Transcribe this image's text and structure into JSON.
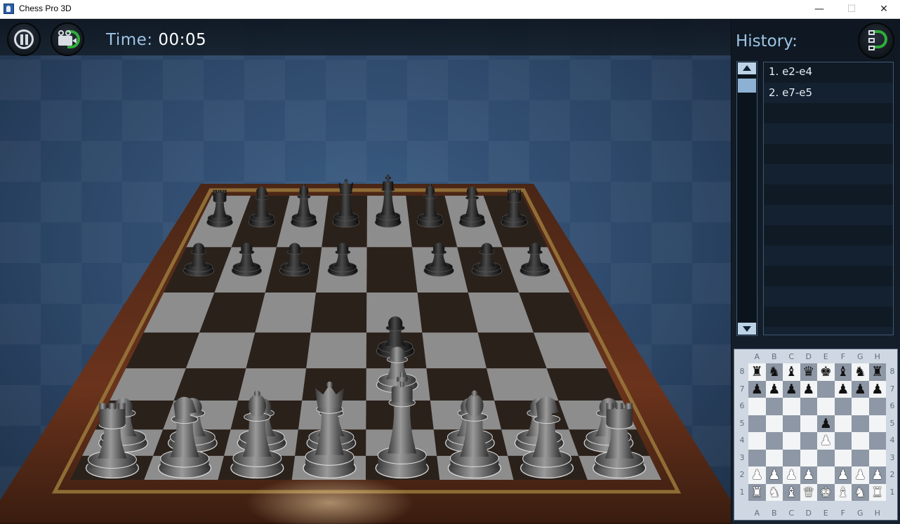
{
  "window": {
    "title": "Chess Pro 3D",
    "minimize_glyph": "—",
    "maximize_glyph": "☐",
    "close_glyph": "✕"
  },
  "hud": {
    "time_label": "Time:",
    "time_value": "00:05",
    "pause_icon": "pause-icon",
    "camera_icon": "camera-rotate-icon"
  },
  "history": {
    "title": "History:",
    "moves": [
      "1. e2-e4",
      "2. e7-e5"
    ],
    "undo_icon": "undo-icon"
  },
  "board": {
    "files": [
      "A",
      "B",
      "C",
      "D",
      "E",
      "F",
      "G",
      "H"
    ],
    "ranks": [
      "8",
      "7",
      "6",
      "5",
      "4",
      "3",
      "2",
      "1"
    ],
    "position": [
      [
        "r",
        "n",
        "b",
        "q",
        "k",
        "b",
        "n",
        "r"
      ],
      [
        "p",
        "p",
        "p",
        "p",
        "",
        "p",
        "p",
        "p"
      ],
      [
        "",
        "",
        "",
        "",
        "",
        "",
        "",
        ""
      ],
      [
        "",
        "",
        "",
        "",
        "p",
        "",
        "",
        ""
      ],
      [
        "",
        "",
        "",
        "",
        "P",
        "",
        "",
        ""
      ],
      [
        "",
        "",
        "",
        "",
        "",
        "",
        "",
        ""
      ],
      [
        "P",
        "P",
        "P",
        "P",
        "",
        "P",
        "P",
        "P"
      ],
      [
        "R",
        "N",
        "B",
        "Q",
        "K",
        "B",
        "N",
        "R"
      ]
    ]
  },
  "colors": {
    "hud_accent": "#9cc3e4",
    "board_light": "#8a8a8a",
    "board_dark": "#2b211b",
    "frame_wood": "#5a2b17",
    "undo_arrow": "#2fae3a"
  }
}
